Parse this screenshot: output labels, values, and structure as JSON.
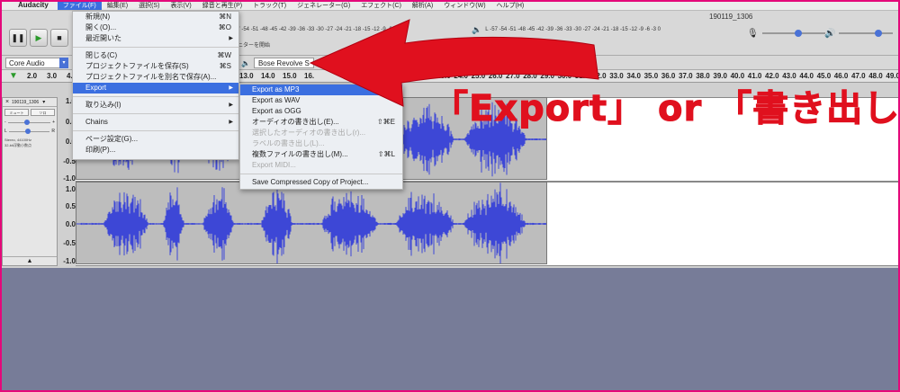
{
  "menubar": {
    "app": "Audacity",
    "items": [
      "ファイル(F)",
      "編集(E)",
      "選択(S)",
      "表示(V)",
      "録音と再生(P)",
      "トラック(T)",
      "ジェネレーター(G)",
      "エフェクト(C)",
      "解析(A)",
      "ウィンドウ(W)",
      "ヘルプ(H)"
    ]
  },
  "window": {
    "title": "190119_1306"
  },
  "toolbar": {
    "host": "Core Audio",
    "output_device": "Bose Revolve S",
    "meter_scale": "-57 -54 -51 -48 -45 -42 -39 -36 -33 -30 -27 -24 -21 -18 -15 -12 -9 -6 -3 0",
    "meter_hint": "モニターを開始",
    "meter_l": "L",
    "meter_r": "R"
  },
  "ruler": {
    "left_ticks": [
      "2.0",
      "3.0",
      "4.0"
    ],
    "right_ticks": [
      "22.0",
      "23.0",
      "24.0",
      "25.0",
      "26.0",
      "27.0",
      "28.0",
      "29.0",
      "30.0",
      "31.0",
      "32.0",
      "33.0",
      "34.0",
      "35.0",
      "36.0",
      "37.0",
      "38.0",
      "39.0",
      "40.0",
      "41.0",
      "42.0",
      "43.0",
      "44.0",
      "45.0",
      "46.0",
      "47.0",
      "48.0",
      "49.0"
    ],
    "mid_ticks": [
      "13.0",
      "14.0",
      "15.0",
      "16."
    ]
  },
  "track": {
    "name": "190119_1306",
    "mute": "ミュート",
    "solo": "ソロ",
    "info_line1": "Stereo, 44100Hz",
    "info_line2": "32-bit浮動小数点",
    "scale_top": [
      "1.0",
      "0.5",
      "0.0",
      "-0.5",
      "-1.0"
    ],
    "scale_bottom": [
      "1.0",
      "0.5",
      "0.0",
      "-0.5",
      "-1.0"
    ]
  },
  "file_menu": {
    "items": [
      {
        "label": "新規(N)",
        "shortcut": "⌘N"
      },
      {
        "label": "開く(O)...",
        "shortcut": "⌘O"
      },
      {
        "label": "最近開いた",
        "shortcut": "▶"
      },
      {
        "label": "閉じる(C)",
        "shortcut": "⌘W"
      },
      {
        "label": "プロジェクトファイルを保存(S)",
        "shortcut": "⌘S"
      },
      {
        "label": "プロジェクトファイルを別名で保存(A)...",
        "shortcut": ""
      },
      {
        "label": "Export",
        "shortcut": "▶"
      },
      {
        "label": "取り込み(I)",
        "shortcut": "▶"
      },
      {
        "label": "Chains",
        "shortcut": "▶"
      },
      {
        "label": "ページ設定(G)...",
        "shortcut": ""
      },
      {
        "label": "印刷(P)...",
        "shortcut": ""
      }
    ]
  },
  "export_menu": {
    "items": [
      {
        "label": "Export as MP3",
        "shortcut": ""
      },
      {
        "label": "Export as WAV",
        "shortcut": ""
      },
      {
        "label": "Export as OGG",
        "shortcut": ""
      },
      {
        "label": "オーディオの書き出し(E)...",
        "shortcut": "⇧⌘E"
      },
      {
        "label": "選択したオーディオの書き出し(r)...",
        "shortcut": ""
      },
      {
        "label": "ラベルの書き出し(L)...",
        "shortcut": ""
      },
      {
        "label": "複数ファイルの書き出し(M)...",
        "shortcut": "⇧⌘L"
      },
      {
        "label": "Export MIDI...",
        "shortcut": ""
      },
      {
        "label": "Save Compressed Copy of Project...",
        "shortcut": ""
      }
    ]
  },
  "annotation": {
    "text": "「Export」 or 「書き出し」"
  },
  "colors": {
    "accent": "#3b6fe0",
    "annotation": "#e0101e",
    "border": "#e4087a",
    "wave": "#3d47d6"
  }
}
